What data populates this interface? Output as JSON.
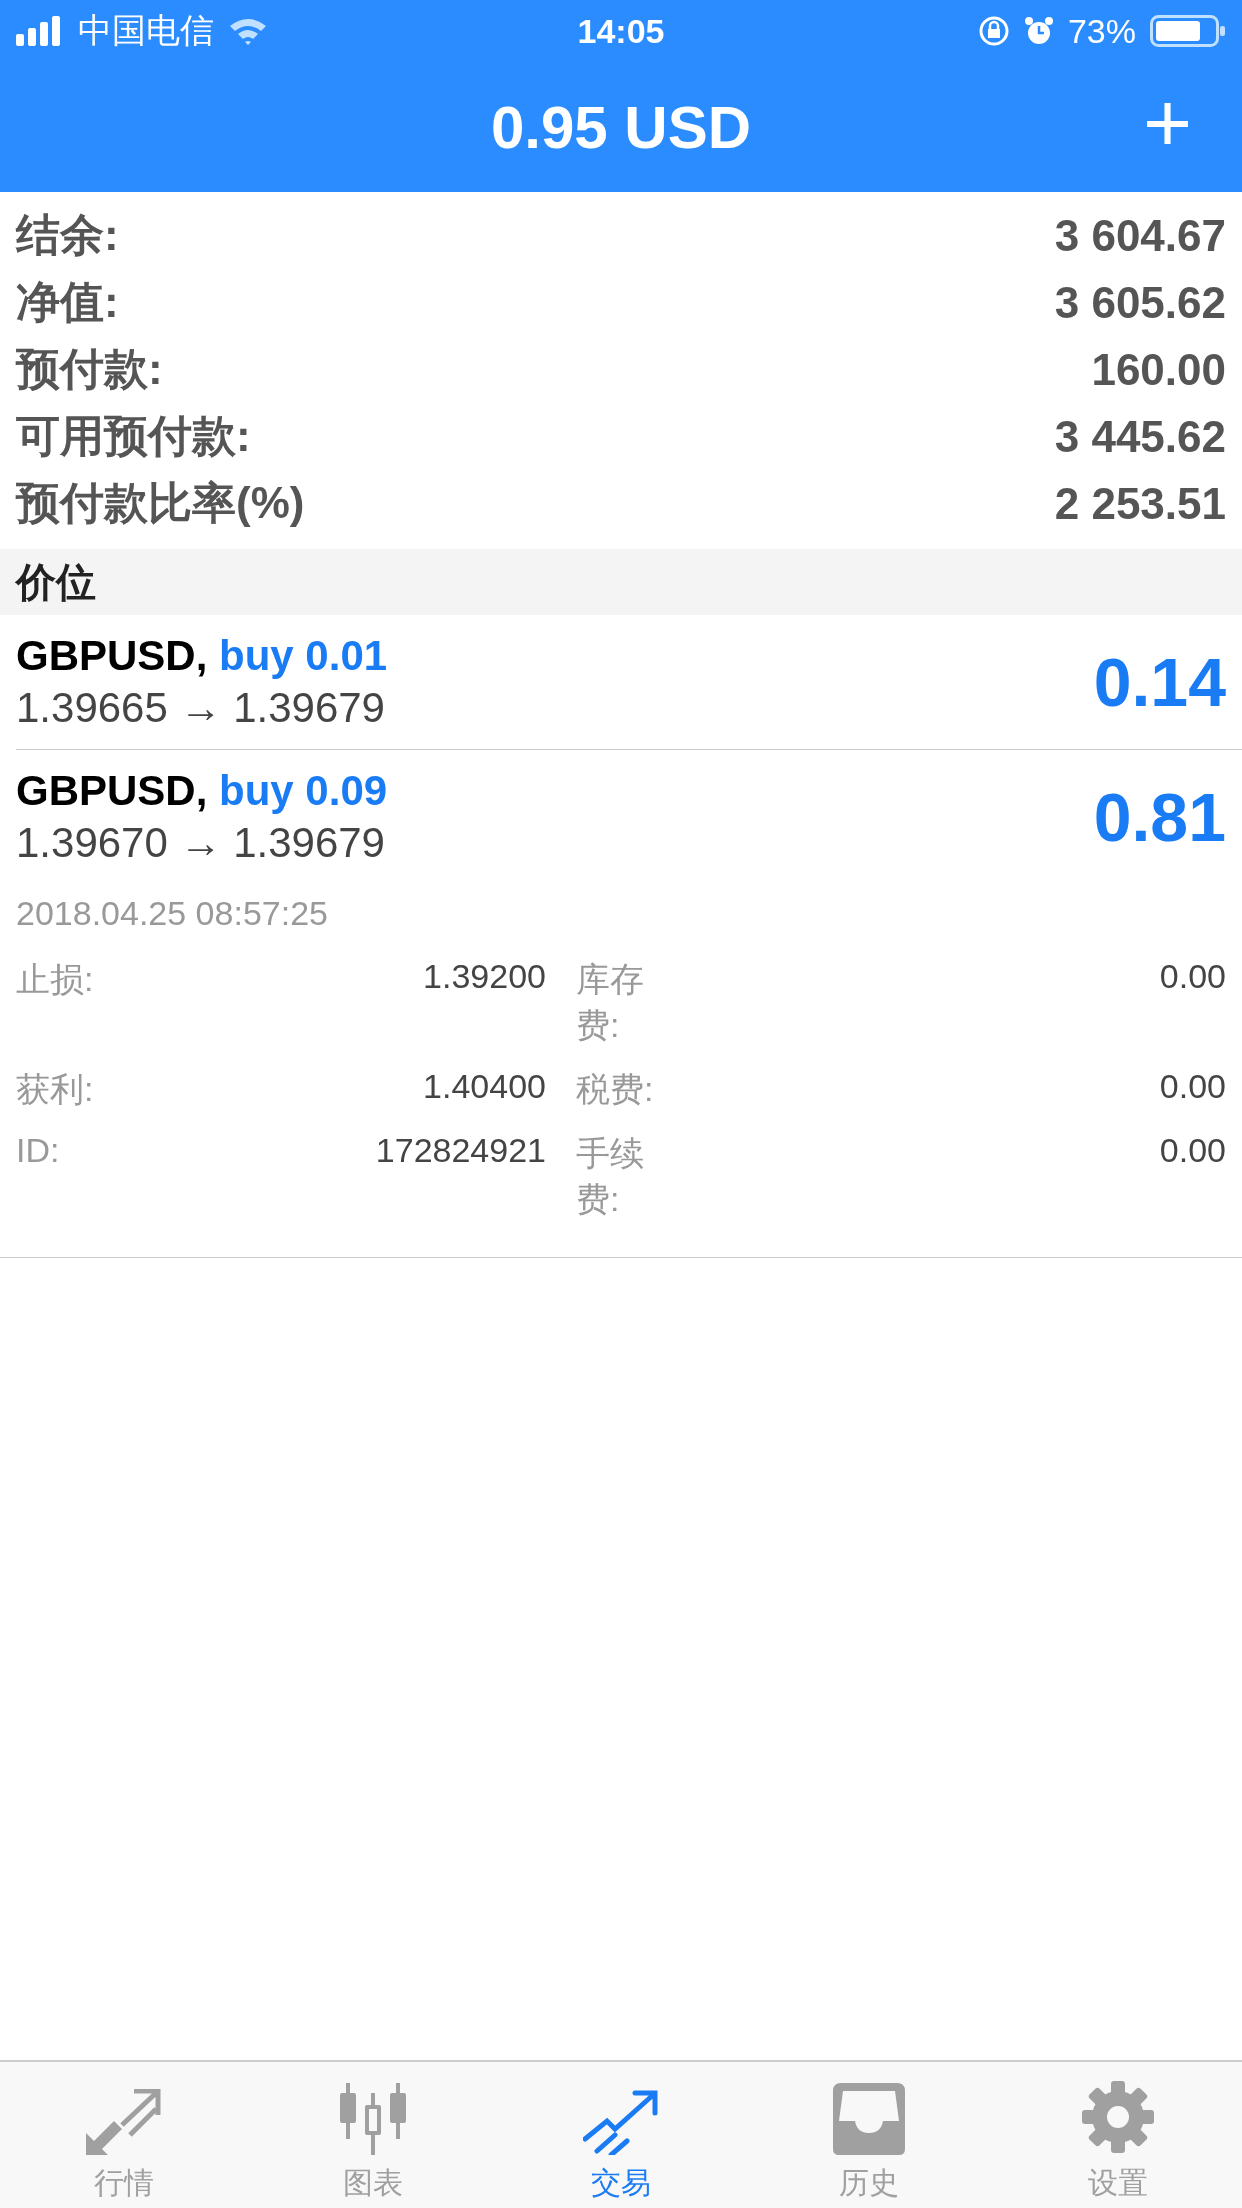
{
  "status_bar": {
    "carrier": "中国电信",
    "time": "14:05",
    "battery": "73%"
  },
  "header": {
    "title": "0.95 USD",
    "add": "+"
  },
  "summary": [
    {
      "label": "结余:",
      "value": "3 604.67"
    },
    {
      "label": "净值:",
      "value": "3 605.62"
    },
    {
      "label": "预付款:",
      "value": "160.00"
    },
    {
      "label": "可用预付款:",
      "value": "3 445.62"
    },
    {
      "label": "预付款比率(%)",
      "value": "2 253.51"
    }
  ],
  "section": "价位",
  "positions": [
    {
      "symbol": "GBPUSD,",
      "order": "buy 0.01",
      "prices": "1.39665 → 1.39679",
      "profit": "0.14",
      "expanded": false
    },
    {
      "symbol": "GBPUSD,",
      "order": "buy 0.09",
      "prices": "1.39670 → 1.39679",
      "profit": "0.81",
      "expanded": true,
      "time": "2018.04.25 08:57:25",
      "details": [
        {
          "label": "止损:",
          "value": "1.39200",
          "label2": "库存费:",
          "value2": "0.00"
        },
        {
          "label": "获利:",
          "value": "1.40400",
          "label2": "税费:",
          "value2": "0.00"
        },
        {
          "label": "ID:",
          "value": "172824921",
          "label2": "手续费:",
          "value2": "0.00"
        }
      ]
    }
  ],
  "tabs": [
    {
      "label": "行情",
      "kind": "quotes",
      "selected": false
    },
    {
      "label": "图表",
      "kind": "chart",
      "selected": false
    },
    {
      "label": "交易",
      "kind": "trade",
      "selected": true
    },
    {
      "label": "历史",
      "kind": "history",
      "selected": false
    },
    {
      "label": "设置",
      "kind": "settings",
      "selected": false
    }
  ]
}
